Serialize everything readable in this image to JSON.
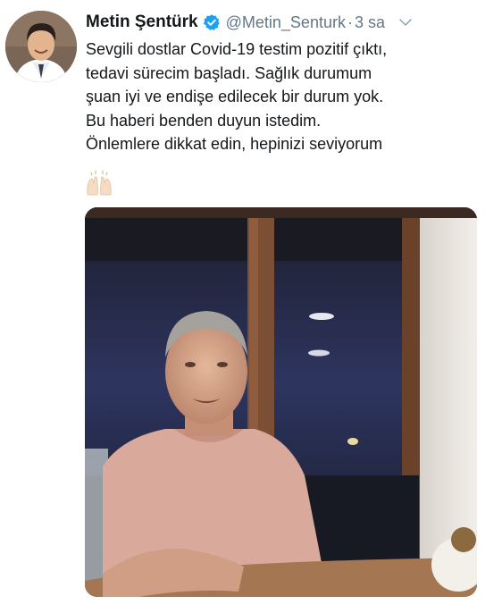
{
  "tweet": {
    "author": {
      "display_name": "Metin Şentürk",
      "handle": "@Metin_Senturk",
      "verified": true,
      "avatar_icon": "profile-photo"
    },
    "separator": "·",
    "time": "3 sa",
    "menu_icon": "chevron-down-icon",
    "text_lines": [
      "Sevgili dostlar Covid-19 testim pozitif çıktı,",
      "tedavi sürecim başladı. Sağlık durumum",
      "şuan iyi ve endişe edilecek bir durum yok.",
      "Bu haberi benden duyun istedim.",
      "Önlemlere dikkat edin, hepinizi seviyorum"
    ],
    "emoji_icon": "raising-hands-emoji",
    "media": {
      "kind": "photo",
      "description_icon": "attached-photo"
    },
    "colors": {
      "text": "#14171a",
      "secondary": "#657786",
      "verified_badge": "#1da1f2"
    }
  }
}
